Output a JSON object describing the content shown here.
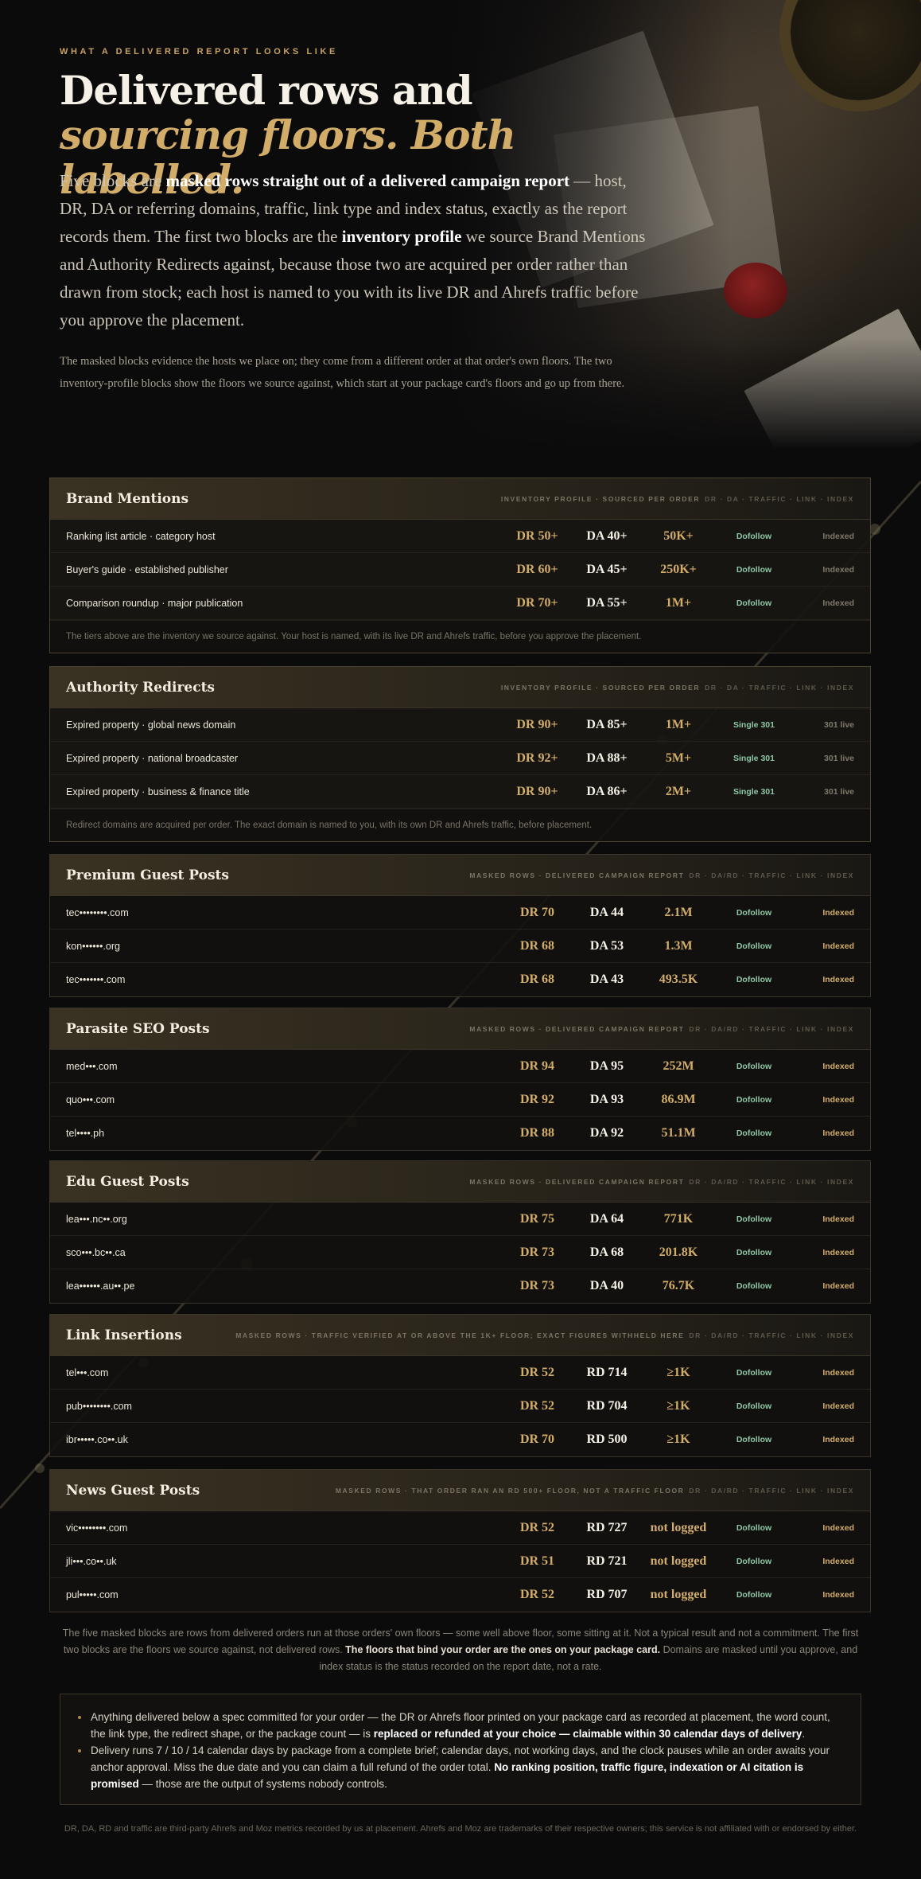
{
  "hero": {
    "eyebrow": "WHAT A DELIVERED REPORT LOOKS LIKE",
    "title_line1": "Delivered rows and",
    "title_line2": "sourcing floors. Both labelled.",
    "lead": {
      "p1": "Five blocks are ",
      "b1": "masked rows straight out of a delivered campaign report",
      "p2": " — host, DR, DA or referring domains, traffic, link type and index status, exactly as the report records them. The first two blocks are the ",
      "b2": "inventory profile",
      "p3": " we source Brand Mentions and Authority Redirects against, because those two are acquired per order rather than drawn from stock; each host is named to you with its live DR and Ahrefs traffic before you approve the placement."
    },
    "sub": "The masked blocks evidence the hosts we place on; they come from a different order at that order's own floors. The two inventory-profile blocks show the floors we source against, which start at your package card's floors and go up from there."
  },
  "blocks": [
    {
      "title": "Brand Mentions",
      "meta": "INVENTORY PROFILE · SOURCED PER ORDER",
      "meta_cols": "DR · DA · TRAFFIC · LINK · INDEX",
      "rows": [
        {
          "host": "Ranking list article · category host",
          "dr": "DR 50+",
          "da": "DA 40+",
          "traffic": "50K+",
          "link": "Dofollow",
          "index": "Indexed"
        },
        {
          "host": "Buyer's guide · established publisher",
          "dr": "DR 60+",
          "da": "DA 45+",
          "traffic": "250K+",
          "link": "Dofollow",
          "index": "Indexed"
        },
        {
          "host": "Comparison roundup · major publication",
          "dr": "DR 70+",
          "da": "DA 55+",
          "traffic": "1M+",
          "link": "Dofollow",
          "index": "Indexed"
        }
      ],
      "footnote": "The tiers above are the inventory we source against. Your host is named, with its live DR and Ahrefs traffic, before you approve the placement."
    },
    {
      "title": "Authority Redirects",
      "meta": "INVENTORY PROFILE · SOURCED PER ORDER",
      "meta_cols": "DR · DA · TRAFFIC · LINK · INDEX",
      "rows": [
        {
          "host": "Expired property · global news domain",
          "dr": "DR 90+",
          "da": "DA 85+",
          "traffic": "1M+",
          "link": "Single 301",
          "index": "301 live"
        },
        {
          "host": "Expired property · national broadcaster",
          "dr": "DR 92+",
          "da": "DA 88+",
          "traffic": "5M+",
          "link": "Single 301",
          "index": "301 live"
        },
        {
          "host": "Expired property · business & finance title",
          "dr": "DR 90+",
          "da": "DA 86+",
          "traffic": "2M+",
          "link": "Single 301",
          "index": "301 live"
        }
      ],
      "footnote": "Redirect domains are acquired per order. The exact domain is named to you, with its own DR and Ahrefs traffic, before placement."
    },
    {
      "title": "Premium Guest Posts",
      "meta": "MASKED ROWS · DELIVERED CAMPAIGN REPORT",
      "meta_cols": "DR · DA/RD · TRAFFIC · LINK · INDEX",
      "rows": [
        {
          "host": "tec••••••••.com",
          "dr": "DR 70",
          "da": "DA 44",
          "traffic": "2.1M",
          "link": "Dofollow",
          "index": "Indexed"
        },
        {
          "host": "kon••••••.org",
          "dr": "DR 68",
          "da": "DA 53",
          "traffic": "1.3M",
          "link": "Dofollow",
          "index": "Indexed"
        },
        {
          "host": "tec•••••••.com",
          "dr": "DR 68",
          "da": "DA 43",
          "traffic": "493.5K",
          "link": "Dofollow",
          "index": "Indexed"
        }
      ]
    },
    {
      "title": "Parasite SEO Posts",
      "meta": "MASKED ROWS · DELIVERED CAMPAIGN REPORT",
      "meta_cols": "DR · DA/RD · TRAFFIC · LINK · INDEX",
      "rows": [
        {
          "host": "med•••.com",
          "dr": "DR 94",
          "da": "DA 95",
          "traffic": "252M",
          "link": "Dofollow",
          "index": "Indexed"
        },
        {
          "host": "quo•••.com",
          "dr": "DR 92",
          "da": "DA 93",
          "traffic": "86.9M",
          "link": "Dofollow",
          "index": "Indexed"
        },
        {
          "host": "tel••••.ph",
          "dr": "DR 88",
          "da": "DA 92",
          "traffic": "51.1M",
          "link": "Dofollow",
          "index": "Indexed"
        }
      ]
    },
    {
      "title": "Edu Guest Posts",
      "meta": "MASKED ROWS · DELIVERED CAMPAIGN REPORT",
      "meta_cols": "DR · DA/RD · TRAFFIC · LINK · INDEX",
      "rows": [
        {
          "host": "lea•••.nc••.org",
          "dr": "DR 75",
          "da": "DA 64",
          "traffic": "771K",
          "link": "Dofollow",
          "index": "Indexed"
        },
        {
          "host": "sco•••.bc••.ca",
          "dr": "DR 73",
          "da": "DA 68",
          "traffic": "201.8K",
          "link": "Dofollow",
          "index": "Indexed"
        },
        {
          "host": "lea••••••.au••.pe",
          "dr": "DR 73",
          "da": "DA 40",
          "traffic": "76.7K",
          "link": "Dofollow",
          "index": "Indexed"
        }
      ]
    },
    {
      "title": "Link Insertions",
      "meta": "MASKED ROWS · TRAFFIC VERIFIED AT OR ABOVE THE 1K+ FLOOR; EXACT FIGURES WITHHELD HERE",
      "meta_cols": "DR · DA/RD · TRAFFIC · LINK · INDEX",
      "rows": [
        {
          "host": "tel•••.com",
          "dr": "DR 52",
          "da": "RD 714",
          "traffic": "≥1K",
          "link": "Dofollow",
          "index": "Indexed"
        },
        {
          "host": "pub••••••••.com",
          "dr": "DR 52",
          "da": "RD 704",
          "traffic": "≥1K",
          "link": "Dofollow",
          "index": "Indexed"
        },
        {
          "host": "ibr•••••.co••.uk",
          "dr": "DR 70",
          "da": "RD 500",
          "traffic": "≥1K",
          "link": "Dofollow",
          "index": "Indexed"
        }
      ]
    },
    {
      "title": "News Guest Posts",
      "meta": "MASKED ROWS · THAT ORDER RAN AN RD 500+ FLOOR, NOT A TRAFFIC FLOOR",
      "meta_cols": "DR · DA/RD · TRAFFIC · LINK · INDEX",
      "rows": [
        {
          "host": "vic••••••••.com",
          "dr": "DR 52",
          "da": "RD 727",
          "traffic": "not logged",
          "link": "Dofollow",
          "index": "Indexed"
        },
        {
          "host": "jli•••.co••.uk",
          "dr": "DR 51",
          "da": "RD 721",
          "traffic": "not logged",
          "link": "Dofollow",
          "index": "Indexed"
        },
        {
          "host": "pul•••••.com",
          "dr": "DR 52",
          "da": "RD 707",
          "traffic": "not logged",
          "link": "Dofollow",
          "index": "Indexed"
        }
      ]
    }
  ],
  "closing": {
    "p1": "The five masked blocks are rows from delivered orders run at those orders' own floors — some well above floor, some sitting at it. Not a typical result and not a commitment. The first two blocks are the floors we source against, not delivered rows. ",
    "b1": "The floors that bind your order are the ones on your package card.",
    "p2": " Domains are masked until you approve, and index status is the status recorded on the report date, not a rate."
  },
  "guarantee": {
    "item1_p1": "Anything delivered below a spec committed for your order — the DR or Ahrefs floor printed on your package card as recorded at placement, the word count, the link type, the redirect shape, or the package count — is ",
    "item1_b": "replaced or refunded at your choice — claimable within 30 calendar days of delivery",
    "item1_p2": ".",
    "item2_p1": "Delivery runs 7 / 10 / 14 calendar days by package from a complete brief; calendar days, not working days, and the clock pauses while an order awaits your anchor approval. Miss the due date and you can claim a full refund of the order total. ",
    "item2_b": "No ranking position, traffic figure, indexation or AI citation is promised",
    "item2_p2": " — those are the output of systems nobody controls."
  },
  "disclaimer": "DR, DA, RD and traffic are third-party Ahrefs and Moz metrics recorded by us at placement. Ahrefs and Moz are trademarks of their respective owners; this service is not affiliated with or endorsed by either."
}
